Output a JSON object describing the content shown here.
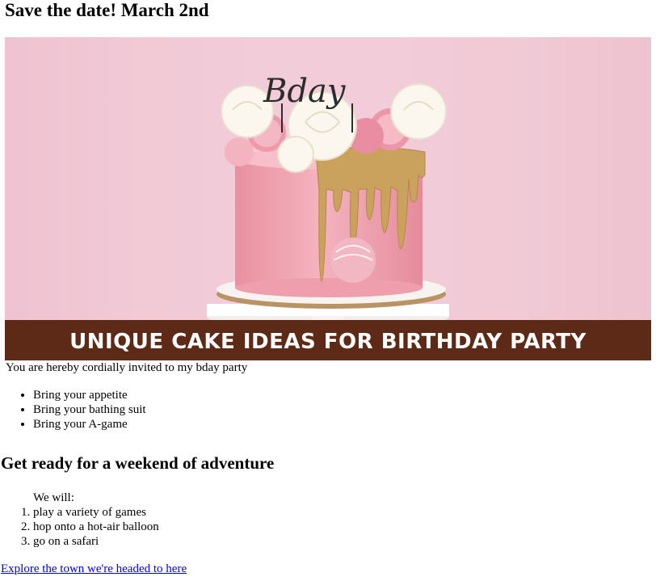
{
  "header": {
    "title": "Save the date! March 2nd"
  },
  "banner": {
    "topper_text": "Bday",
    "caption": "UNIQUE CAKE IDEAS FOR BIRTHDAY PARTY"
  },
  "intro": {
    "text": "You are hereby cordially invited to my bday party"
  },
  "bullets": {
    "items": [
      "Bring your appetite",
      "Bring your bathing suit",
      "Bring your A-game"
    ]
  },
  "adventure": {
    "title": "Get ready for a weekend of adventure",
    "lead": "We will:",
    "steps": [
      "play a variety of games",
      "hop onto a hot-air balloon",
      "go on a safari"
    ]
  },
  "link": {
    "label": "Explore the town we're headed to here"
  },
  "colors": {
    "banner_background": "#f2c9d6",
    "caption_background": "#5c2a16",
    "cake_pink": "#f0a7b5",
    "gold_drip": "#c9a35e",
    "link": "#0000ee"
  }
}
